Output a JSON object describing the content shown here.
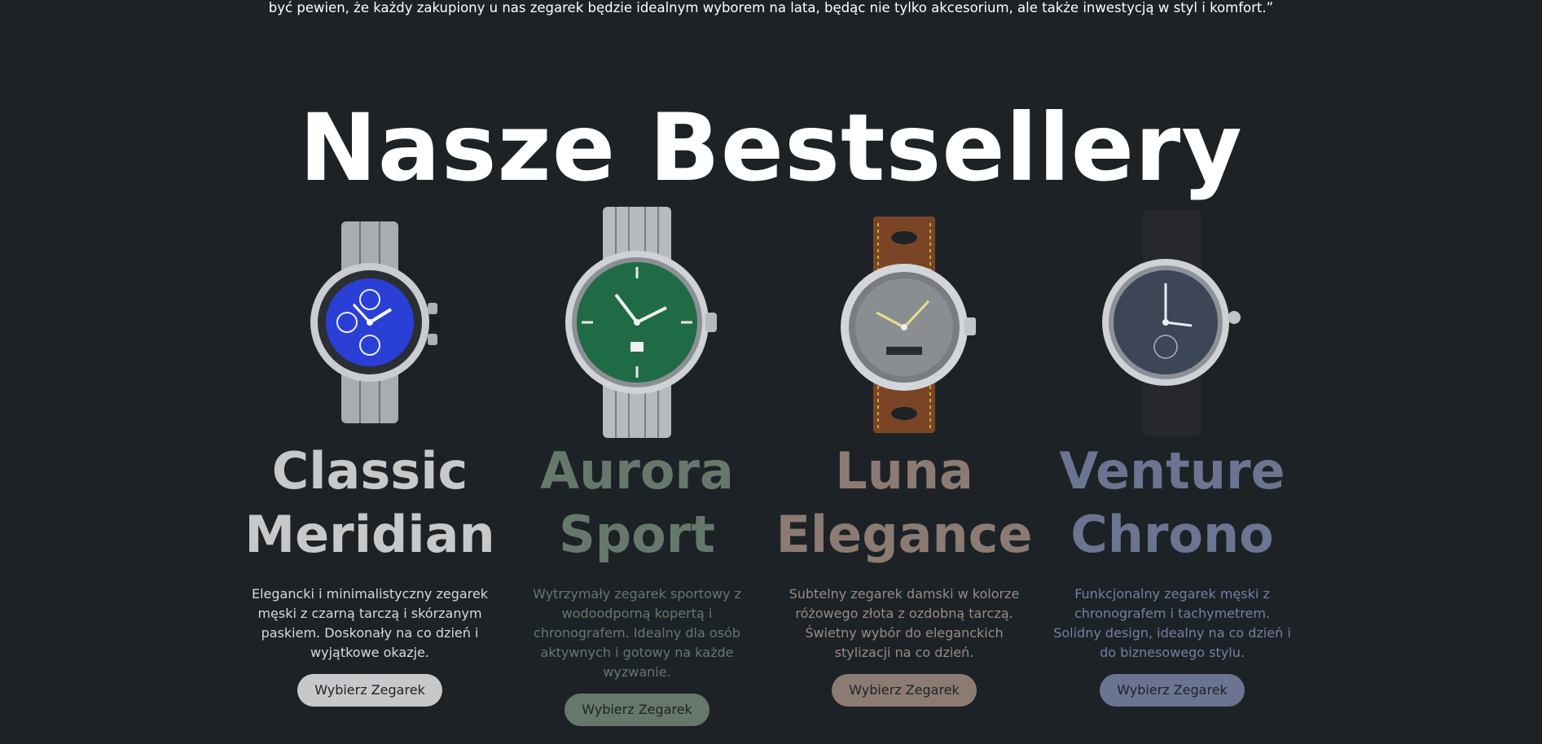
{
  "intro": {
    "text": "być pewien, że każdy zakupiony u nas zegarek będzie idealnym wyborem na lata, będąc nie tylko akcesorium, ale także inwestycją w styl i komfort.”"
  },
  "section": {
    "title": "Nasze Bestsellery"
  },
  "products": [
    {
      "name_line1": "Classic",
      "name_line2": "Meridian",
      "description": "Elegancki i minimalistyczny zegarek męski z czarną tarczą i skórzanym paskiem. Doskonały na co dzień i wyjątkowe okazje.",
      "button_label": "Wybierz Zegarek",
      "accent_color": "#c8c8c8",
      "text_color": "#d9d9d9",
      "image_icon": "chronograph-watch-blue-dial",
      "dial_color": "#2a3fd6"
    },
    {
      "name_line1": "Aurora",
      "name_line2": "Sport",
      "description": "Wytrzymały zegarek sportowy z wodoodporną kopertą i chronografem. Idealny dla osób aktywnych i gotowy na każde wyzwanie.",
      "button_label": "Wybierz Zegarek",
      "accent_color": "#66786c",
      "text_color": "#66786c",
      "image_icon": "steel-watch-green-dial",
      "dial_color": "#1f6b45"
    },
    {
      "name_line1": "Luna",
      "name_line2": "Elegance",
      "description": "Subtelny zegarek damski w kolorze różowego złota z ozdobną tarczą. Świetny wybór do eleganckich stylizacji na co dzień.",
      "button_label": "Wybierz Zegarek",
      "accent_color": "#8c7b73",
      "text_color": "#9b8a82",
      "image_icon": "watch-brown-leather-grey-dial",
      "dial_color": "#7a7d80"
    },
    {
      "name_line1": "Venture",
      "name_line2": "Chrono",
      "description": "Funkcjonalny zegarek męski z chronografem i tachymetrem. Solidny design, idealny na co dzień i do biznesowego stylu.",
      "button_label": "Wybierz Zegarek",
      "accent_color": "#6b7490",
      "text_color": "#7580a4",
      "image_icon": "watch-black-strap-slate-dial",
      "dial_color": "#3d4657"
    }
  ]
}
